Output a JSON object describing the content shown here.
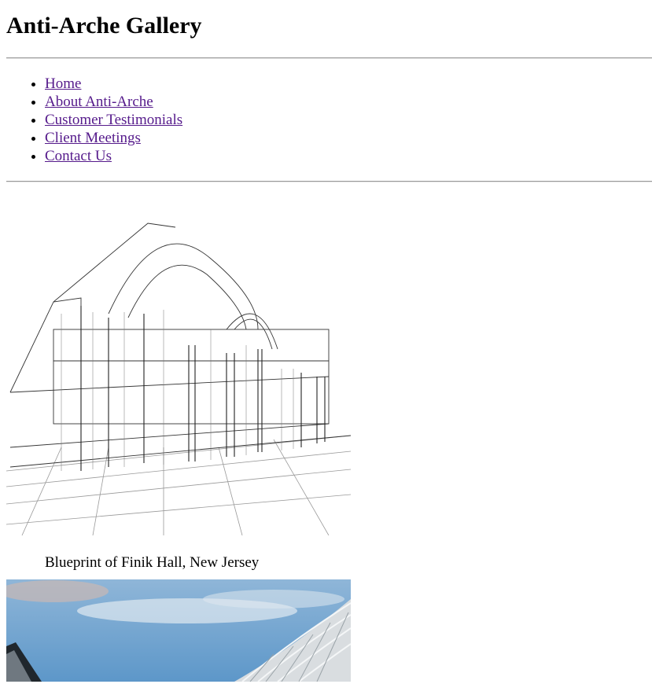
{
  "site": {
    "title": "Anti-Arche Gallery"
  },
  "nav": {
    "items": [
      {
        "label": "Home"
      },
      {
        "label": "About Anti-Arche"
      },
      {
        "label": "Customer Testimonials"
      },
      {
        "label": "Client Meetings"
      },
      {
        "label": "Contact Us"
      }
    ],
    "link_color": "#551a8b"
  },
  "gallery": {
    "items": [
      {
        "caption": "Blueprint of Finik Hall, New Jersey",
        "image": "architectural-wireframe-drawing"
      },
      {
        "caption": "",
        "image": "glass-roof-building-photo"
      }
    ]
  }
}
